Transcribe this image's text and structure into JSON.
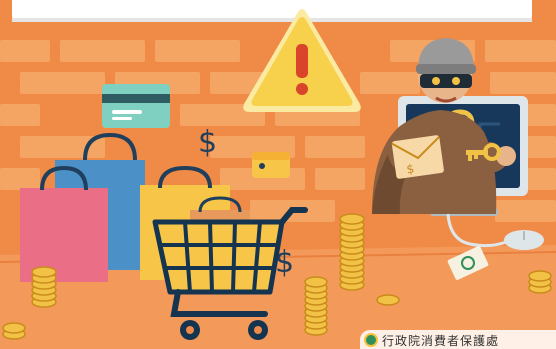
{
  "credit": {
    "organization": "行政院消費者保護處"
  },
  "icons": {
    "warning": "warning-triangle-icon",
    "dollar_sign": "$",
    "lock": "unlocked-padlock-icon",
    "key": "key-icon",
    "wallet": "wallet-icon",
    "credit_card": "credit-card-icon"
  },
  "colors": {
    "background": "#f08a47",
    "brick": "#f4a463",
    "warning_yellow": "#f7d14b",
    "warning_mark": "#d9452b",
    "cart_blue": "#15344f",
    "coin_gold": "#f2c246",
    "bag_pink": "#ea6f86",
    "bag_blue": "#4b90c7",
    "bag_yellow": "#f7c548",
    "card_teal": "#7fd0c0",
    "monitor": "#dfe6ea",
    "screen": "#17385a"
  }
}
